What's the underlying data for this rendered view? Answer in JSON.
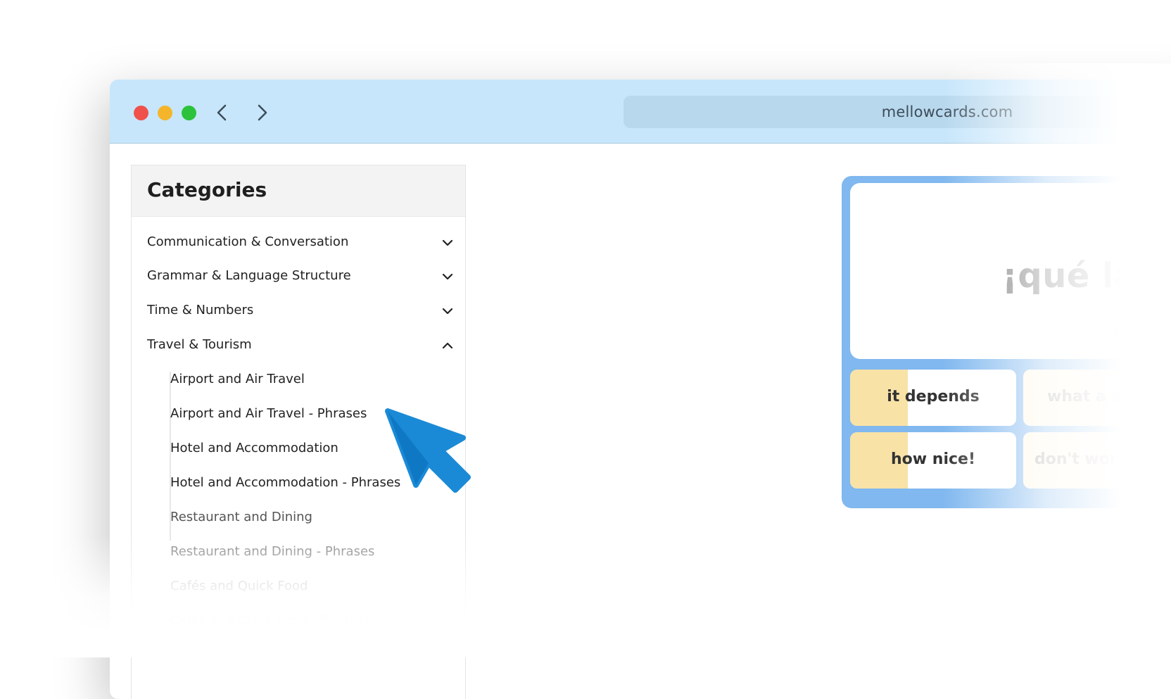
{
  "browser": {
    "url": "mellowcards.com"
  },
  "sidebar": {
    "title": "Categories",
    "categories": [
      {
        "label": "Communication & Conversation",
        "expanded": false
      },
      {
        "label": "Grammar & Language Structure",
        "expanded": false
      },
      {
        "label": "Time & Numbers",
        "expanded": false
      },
      {
        "label": "Travel & Tourism",
        "expanded": true
      }
    ],
    "subcategories": [
      {
        "label": "Airport and Air Travel"
      },
      {
        "label": "Airport and Air Travel - Phrases"
      },
      {
        "label": "Hotel and Accommodation"
      },
      {
        "label": "Hotel and Accommodation - Phrases"
      },
      {
        "label": "Restaurant and Dining"
      },
      {
        "label": "Restaurant and Dining - Phrases"
      },
      {
        "label": "Cafés and Quick Food"
      },
      {
        "label": "Cafés and Quick Food - Phrases"
      }
    ]
  },
  "flashcard": {
    "prompt": "¡qué lá",
    "options": [
      {
        "label": "it depends"
      },
      {
        "label": "what a s"
      },
      {
        "label": "how nice!"
      },
      {
        "label": "don't wor"
      }
    ]
  },
  "colors": {
    "titlebar": "#c7e6fb",
    "card_frame": "#80b8ef",
    "option_fill": "#f8e2a6",
    "cursor": "#1b8ad6"
  }
}
